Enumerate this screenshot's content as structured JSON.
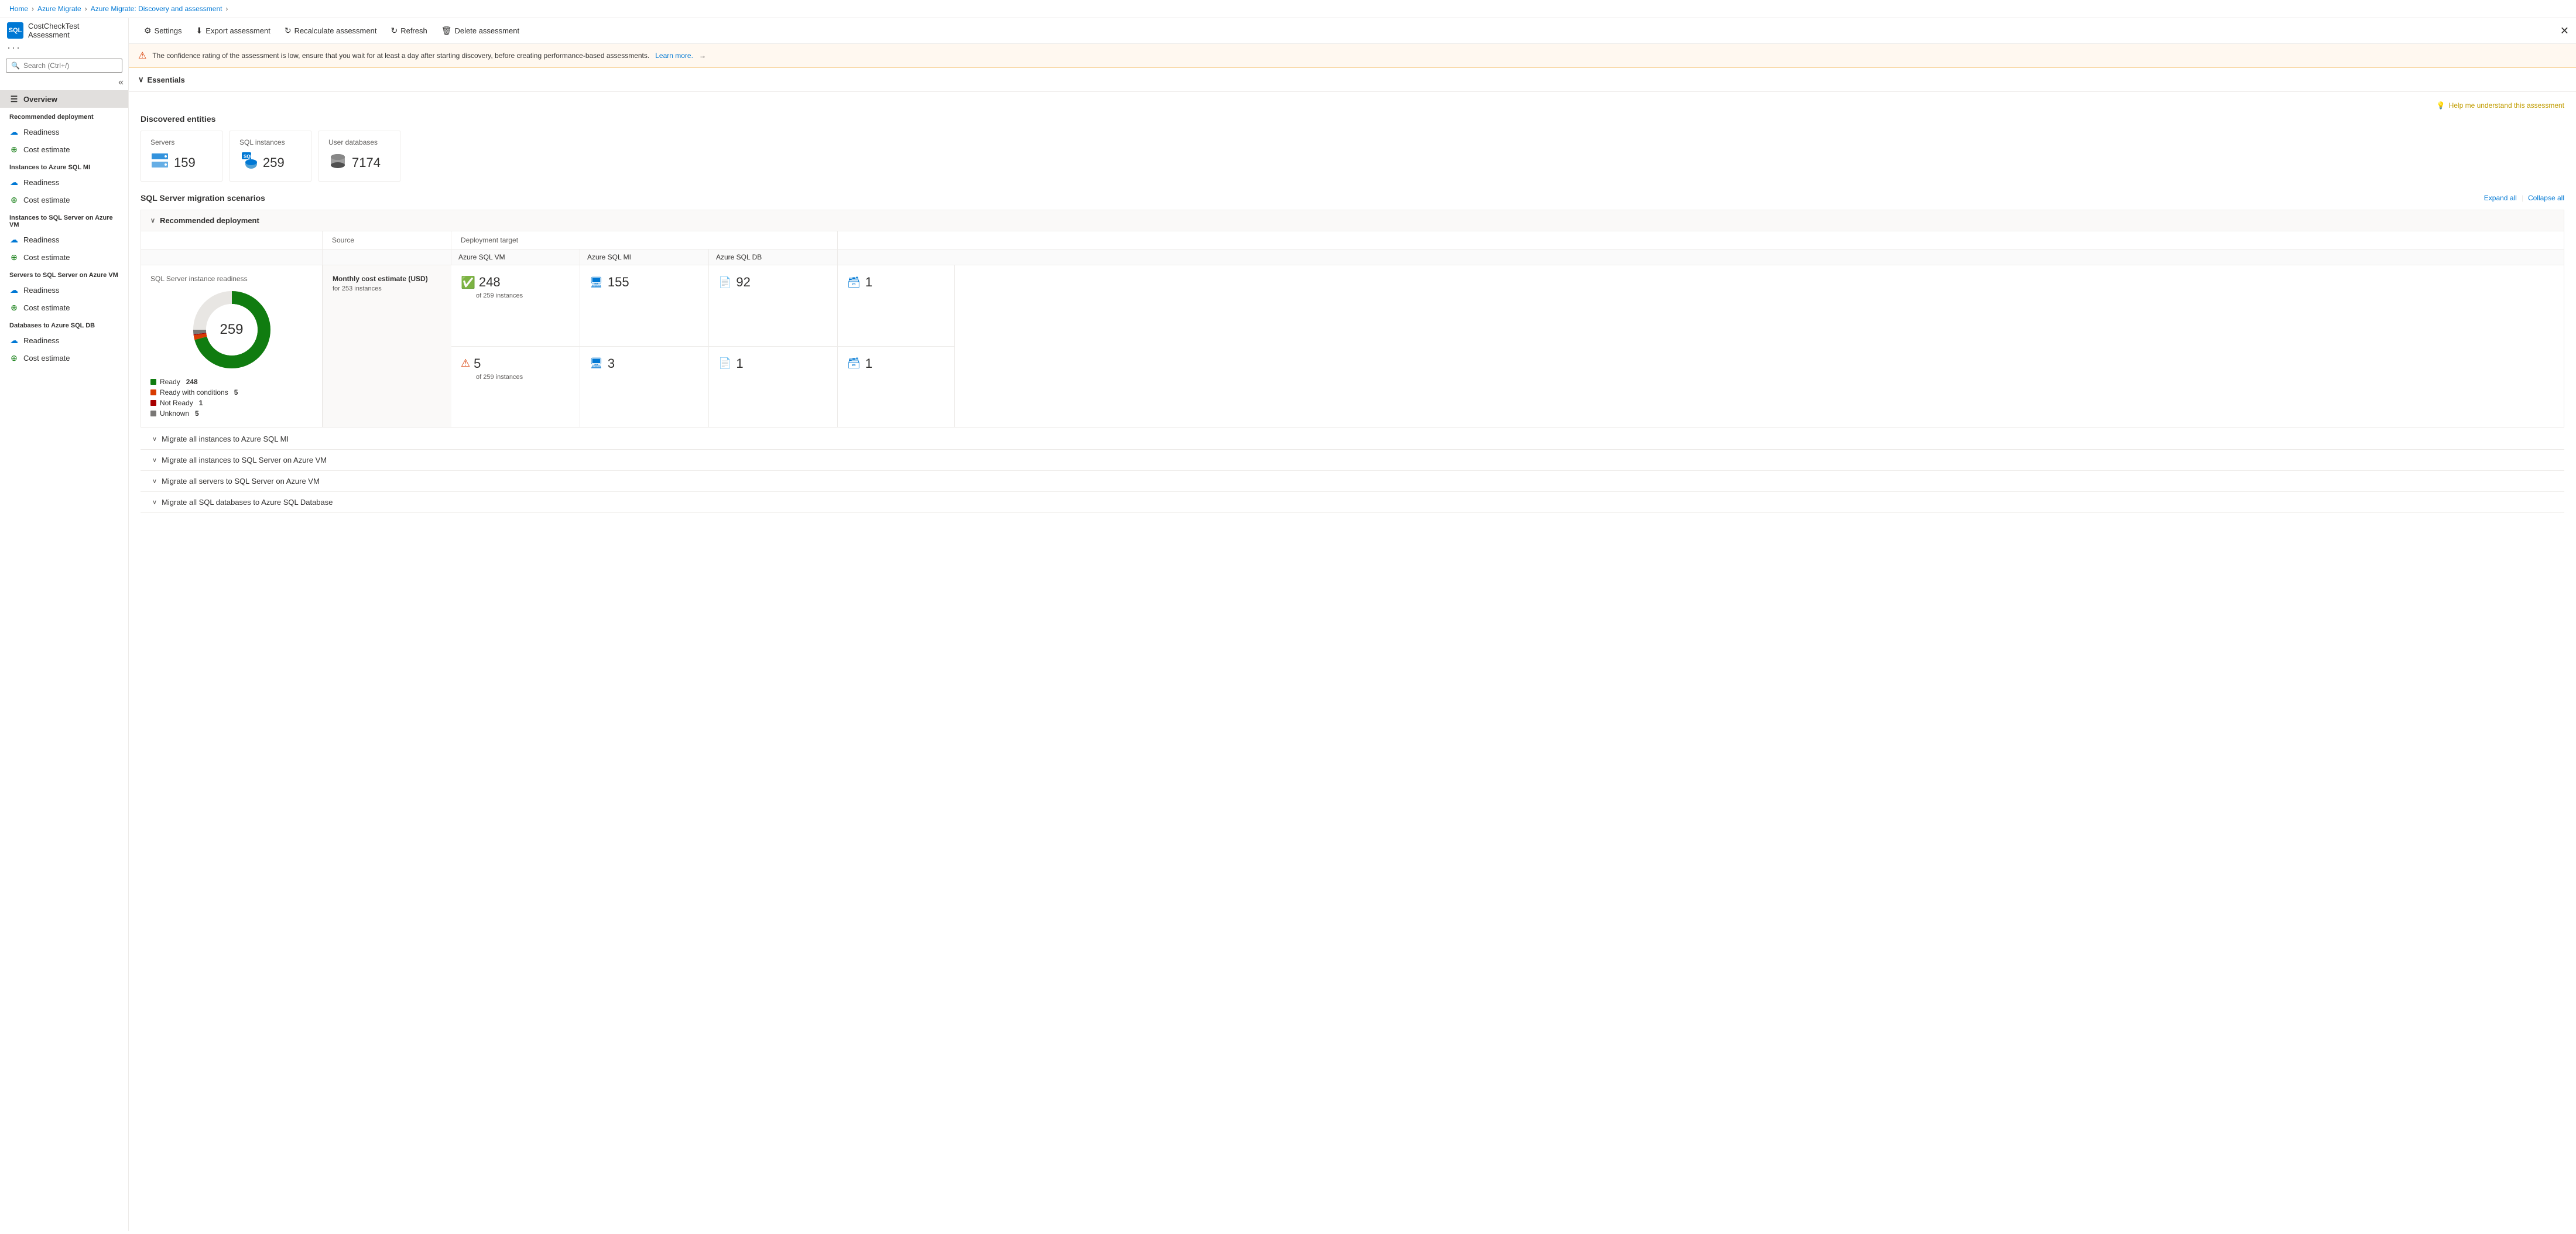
{
  "breadcrumb": {
    "items": [
      "Home",
      "Azure Migrate",
      "Azure Migrate: Discovery and assessment"
    ]
  },
  "sidebar": {
    "app_name": "CostCheckTest",
    "app_subtitle": "Assessment",
    "search_placeholder": "Search (Ctrl+/)",
    "nav": [
      {
        "id": "overview",
        "label": "Overview",
        "active": true,
        "icon": "☰"
      },
      {
        "id": "rec-deployment-header",
        "label": "Recommended deployment",
        "section": true
      },
      {
        "id": "rec-readiness",
        "label": "Readiness",
        "icon": "☁",
        "icon_type": "cloud-blue"
      },
      {
        "id": "rec-cost",
        "label": "Cost estimate",
        "icon": "⊕",
        "icon_type": "cost-green"
      },
      {
        "id": "sql-mi-header",
        "label": "Instances to Azure SQL MI",
        "section": true
      },
      {
        "id": "mi-readiness",
        "label": "Readiness",
        "icon": "☁",
        "icon_type": "cloud-blue"
      },
      {
        "id": "mi-cost",
        "label": "Cost estimate",
        "icon": "⊕",
        "icon_type": "cost-green"
      },
      {
        "id": "sql-vm-header",
        "label": "Instances to SQL Server on Azure VM",
        "section": true
      },
      {
        "id": "vm-readiness",
        "label": "Readiness",
        "icon": "☁",
        "icon_type": "cloud-blue"
      },
      {
        "id": "vm-cost",
        "label": "Cost estimate",
        "icon": "⊕",
        "icon_type": "cost-green"
      },
      {
        "id": "servers-vm-header",
        "label": "Servers to SQL Server on Azure VM",
        "section": true
      },
      {
        "id": "servers-readiness",
        "label": "Readiness",
        "icon": "☁",
        "icon_type": "cloud-blue"
      },
      {
        "id": "servers-cost",
        "label": "Cost estimate",
        "icon": "⊕",
        "icon_type": "cost-green"
      },
      {
        "id": "db-header",
        "label": "Databases to Azure SQL DB",
        "section": true
      },
      {
        "id": "db-readiness",
        "label": "Readiness",
        "icon": "☁",
        "icon_type": "cloud-blue"
      },
      {
        "id": "db-cost",
        "label": "Cost estimate",
        "icon": "⊕",
        "icon_type": "cost-green"
      }
    ]
  },
  "toolbar": {
    "buttons": [
      {
        "id": "settings",
        "label": "Settings",
        "icon": "⚙"
      },
      {
        "id": "export",
        "label": "Export assessment",
        "icon": "⬇"
      },
      {
        "id": "recalculate",
        "label": "Recalculate assessment",
        "icon": "↻"
      },
      {
        "id": "refresh",
        "label": "Refresh",
        "icon": "↻"
      },
      {
        "id": "delete",
        "label": "Delete assessment",
        "icon": "🗑"
      }
    ]
  },
  "warning": {
    "text": "The confidence rating of the assessment is low, ensure that you wait for at least a day after starting discovery, before creating performance-based assessments.",
    "link": "Learn more.",
    "arrow": "→"
  },
  "essentials": {
    "label": "Essentials"
  },
  "discovered_entities": {
    "title": "Discovered entities",
    "cards": [
      {
        "id": "servers",
        "label": "Servers",
        "value": "159"
      },
      {
        "id": "sql-instances",
        "label": "SQL instances",
        "value": "259"
      },
      {
        "id": "user-databases",
        "label": "User databases",
        "value": "7174"
      }
    ]
  },
  "migration_scenarios": {
    "title": "SQL Server migration scenarios",
    "expand_label": "Expand all",
    "collapse_label": "Collapse all"
  },
  "recommended_deployment": {
    "title": "Recommended deployment",
    "chart": {
      "title": "SQL Server instance readiness",
      "center_value": "259",
      "segments": [
        {
          "label": "Ready",
          "value": 248,
          "color": "#107c10",
          "percent": 95.75
        },
        {
          "label": "Ready with conditions",
          "value": 5,
          "color": "#d83b01",
          "percent": 1.93
        },
        {
          "label": "Not Ready",
          "value": 1,
          "color": "#a80000",
          "percent": 0.39
        },
        {
          "label": "Unknown",
          "value": 5,
          "color": "#797775",
          "percent": 1.93
        }
      ]
    },
    "source_col": "Source",
    "deployment_col": "Deployment target",
    "rows": [
      {
        "source_label": "Instances",
        "source_value": "248",
        "source_sub": "of 259 instances",
        "source_status": "ready",
        "azure_sql_vm": "155",
        "azure_sql_mi": "92",
        "azure_sql_db": "1"
      },
      {
        "source_label": "Instances",
        "source_value": "5",
        "source_sub": "of 259 instances",
        "source_status": "warning",
        "azure_sql_vm": "3",
        "azure_sql_mi": "1",
        "azure_sql_db": "1"
      }
    ],
    "cost": {
      "title": "Monthly cost estimate (USD)",
      "subtitle": "for 253 instances"
    }
  },
  "collapse_sections": [
    {
      "id": "migrate-mi",
      "label": "Migrate all instances to Azure SQL MI"
    },
    {
      "id": "migrate-sqlvm",
      "label": "Migrate all instances to SQL Server on Azure VM"
    },
    {
      "id": "migrate-servers-vm",
      "label": "Migrate all servers to SQL Server on Azure VM"
    },
    {
      "id": "migrate-db",
      "label": "Migrate all SQL databases to Azure SQL Database"
    }
  ],
  "help": {
    "label": "Help me understand this assessment"
  },
  "colors": {
    "ready": "#107c10",
    "ready_conditions": "#d83b01",
    "not_ready": "#a80000",
    "unknown": "#797775",
    "blue": "#0078d4",
    "accent": "#c19c00"
  }
}
